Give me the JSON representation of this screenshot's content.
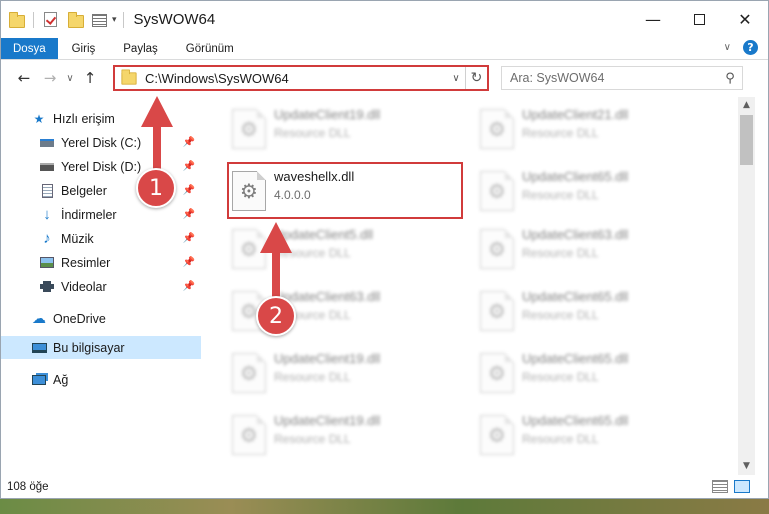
{
  "window": {
    "title": "SysWOW64"
  },
  "ribbon": {
    "tabs": [
      "Dosya",
      "Giriş",
      "Paylaş",
      "Görünüm"
    ],
    "help_label": "?"
  },
  "address": {
    "path": "C:\\Windows\\SysWOW64",
    "search_placeholder": "Ara: SysWOW64"
  },
  "sidebar": {
    "items": [
      {
        "label": "Hızlı erişim",
        "icon": "star-icon",
        "pinned": false
      },
      {
        "label": "Yerel Disk (C:)",
        "icon": "drive-icon",
        "pinned": true
      },
      {
        "label": "Yerel Disk (D:)",
        "icon": "drive-icon",
        "pinned": true
      },
      {
        "label": "Belgeler",
        "icon": "documents-icon",
        "pinned": true
      },
      {
        "label": "İndirmeler",
        "icon": "download-icon",
        "pinned": true
      },
      {
        "label": "Müzik",
        "icon": "music-icon",
        "pinned": true
      },
      {
        "label": "Resimler",
        "icon": "pictures-icon",
        "pinned": true
      },
      {
        "label": "Videolar",
        "icon": "videos-icon",
        "pinned": true
      },
      {
        "label": "OneDrive",
        "icon": "cloud-icon",
        "pinned": false
      },
      {
        "label": "Bu bilgisayar",
        "icon": "computer-icon",
        "pinned": false,
        "selected": true
      },
      {
        "label": "Ağ",
        "icon": "network-icon",
        "pinned": false
      }
    ]
  },
  "files": {
    "highlighted": {
      "name": "waveshellx.dll",
      "sub": "4.0.0.0"
    },
    "left_column": [
      {
        "name": "UpdateClient19.dll",
        "sub": "Resource DLL"
      },
      {
        "name": "UpdateClient5.dll",
        "sub": "Resource DLL"
      },
      {
        "name": "UpdateClient63.dll",
        "sub": "Resource DLL"
      },
      {
        "name": "UpdateClient19.dll",
        "sub": "Resource DLL"
      },
      {
        "name": "UpdateClient19.dll",
        "sub": "Resource DLL"
      }
    ],
    "right_column": [
      {
        "name": "UpdateClient21.dll",
        "sub": "Resource DLL"
      },
      {
        "name": "UpdateClient65.dll",
        "sub": "Resource DLL"
      },
      {
        "name": "UpdateClient63.dll",
        "sub": "Resource DLL"
      },
      {
        "name": "UpdateClient65.dll",
        "sub": "Resource DLL"
      },
      {
        "name": "UpdateClient65.dll",
        "sub": "Resource DLL"
      },
      {
        "name": "UpdateClient65.dll",
        "sub": "Resource DLL"
      }
    ]
  },
  "status": {
    "item_count": "108 öğe"
  },
  "callouts": {
    "step1": "1",
    "step2": "2"
  },
  "colors": {
    "accent": "#1979ca",
    "callout": "#d94848",
    "highlight_border": "#d13b3b"
  }
}
